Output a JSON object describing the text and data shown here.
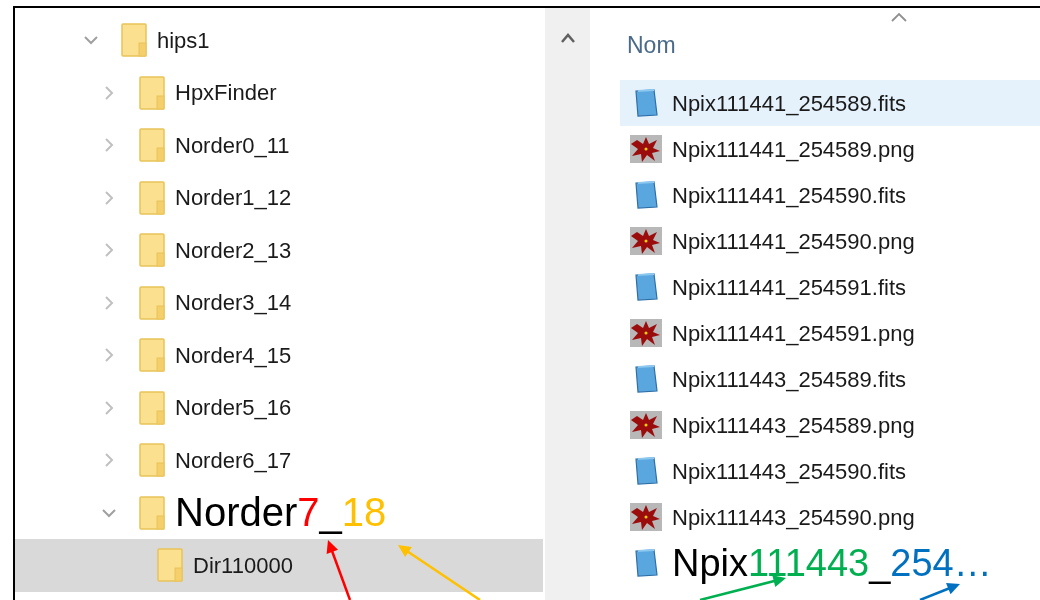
{
  "tree": {
    "label": "hips1",
    "expanded": true,
    "children": [
      {
        "label": "HpxFinder",
        "expanded": false
      },
      {
        "label": "Norder0_11",
        "expanded": false
      },
      {
        "label": "Norder1_12",
        "expanded": false
      },
      {
        "label": "Norder2_13",
        "expanded": false
      },
      {
        "label": "Norder3_14",
        "expanded": false
      },
      {
        "label": "Norder4_15",
        "expanded": false
      },
      {
        "label": "Norder5_16",
        "expanded": false
      },
      {
        "label": "Norder6_17",
        "expanded": false
      },
      {
        "expanded": true,
        "parts": [
          {
            "text": "Norder",
            "color": "#000000",
            "arrow": false
          },
          {
            "text": "7",
            "color": "#ff0000",
            "arrow": true
          },
          {
            "text": "_",
            "color": "#000000",
            "arrow": false
          },
          {
            "text": "18",
            "color": "#ffc000",
            "arrow": true
          }
        ],
        "children": [
          {
            "label": "Dir110000",
            "selected": true
          }
        ]
      }
    ]
  },
  "files": {
    "column": "Nom",
    "rows": [
      {
        "name": "Npix111441_254589.fits",
        "kind": "fits",
        "selected": true
      },
      {
        "name": "Npix111441_254589.png",
        "kind": "png",
        "selected": false
      },
      {
        "name": "Npix111441_254590.fits",
        "kind": "fits",
        "selected": false
      },
      {
        "name": "Npix111441_254590.png",
        "kind": "png",
        "selected": false
      },
      {
        "name": "Npix111441_254591.fits",
        "kind": "fits",
        "selected": false
      },
      {
        "name": "Npix111441_254591.png",
        "kind": "png",
        "selected": false
      },
      {
        "name": "Npix111443_254589.fits",
        "kind": "fits",
        "selected": false
      },
      {
        "name": "Npix111443_254589.png",
        "kind": "png",
        "selected": false
      },
      {
        "name": "Npix111443_254590.fits",
        "kind": "fits",
        "selected": false
      },
      {
        "name": "Npix111443_254590.png",
        "kind": "png",
        "selected": false
      },
      {
        "kind": "fits",
        "selected": false,
        "parts": [
          {
            "text": "Npix",
            "color": "#000000",
            "arrow": false
          },
          {
            "text": "111443",
            "color": "#00b050",
            "arrow": true
          },
          {
            "text": "_",
            "color": "#000000",
            "arrow": false
          },
          {
            "text": "254…",
            "color": "#0070c0",
            "arrow": true
          }
        ]
      }
    ]
  }
}
